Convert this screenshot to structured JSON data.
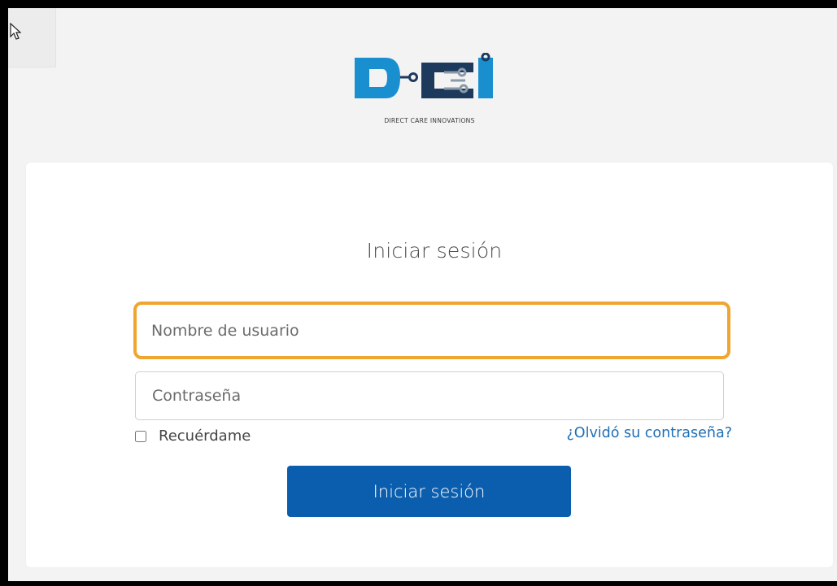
{
  "logo": {
    "text": "DCI",
    "tagline": "DIRECT CARE INNOVATIONS",
    "colors": {
      "blue": "#1a8fd0",
      "dark": "#1d3a5c",
      "gray": "#8a9aa8"
    }
  },
  "login": {
    "title": "Iniciar sesión",
    "username": {
      "placeholder": "Nombre de usuario",
      "value": ""
    },
    "password": {
      "placeholder": "Contraseña",
      "value": ""
    },
    "remember_label": "Recuérdame",
    "remember_checked": false,
    "forgot_link": "¿Olvidó su contraseña?",
    "submit_label": "Iniciar sesión"
  },
  "colors": {
    "focus_highlight": "#eea630",
    "primary_button": "#0b5ead",
    "link": "#1f6fb5",
    "page_background": "#f3f3f3"
  }
}
